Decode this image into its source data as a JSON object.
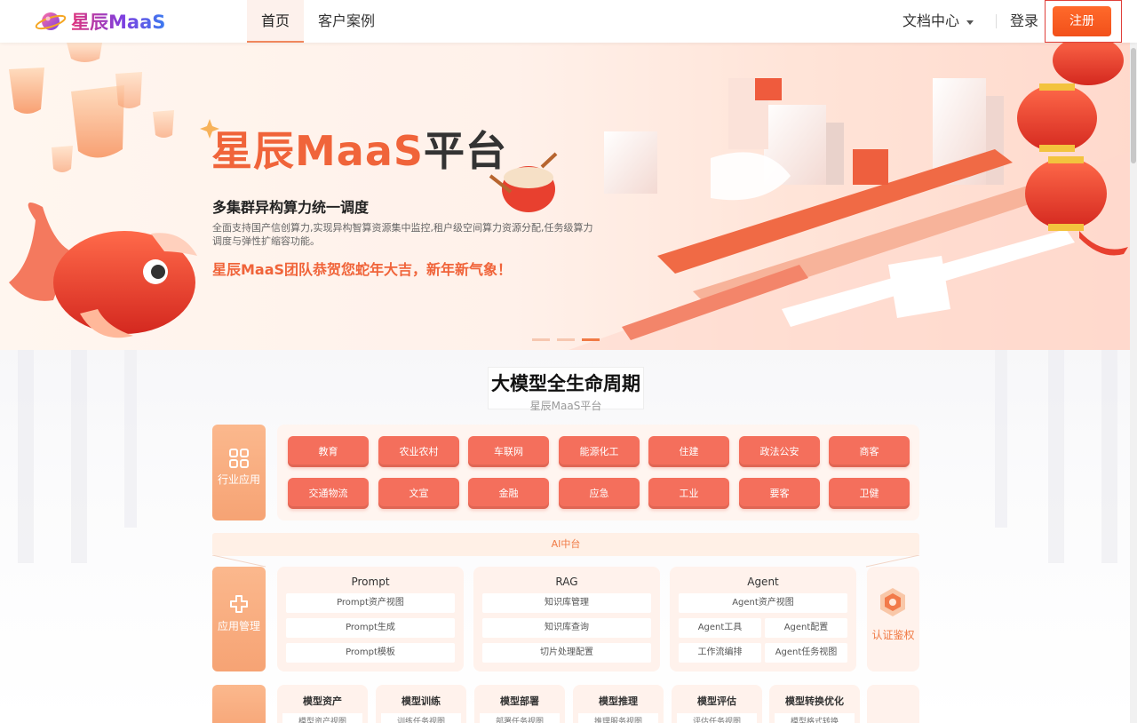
{
  "header": {
    "brand": "星辰MaaS",
    "nav": [
      {
        "label": "首页",
        "active": true
      },
      {
        "label": "客户案例",
        "active": false
      }
    ],
    "docs_label": "文档中心",
    "login_label": "登录",
    "register_label": "注册"
  },
  "banner": {
    "title_part1": "星辰MaaS",
    "title_part2": "平台",
    "subtitle": "多集群异构算力统一调度",
    "description": "全面支持国产信创算力,实现异构智算资源集中监控,租户级空间算力资源分配,任务级算力调度与弹性扩缩容功能。",
    "greeting": "星辰MaaS团队恭贺您蛇年大吉，新年新气象！",
    "slide_indicator": {
      "count": 3,
      "active": 3
    }
  },
  "lifecycle": {
    "title": "大模型全生命周期",
    "subtitle": "星辰MaaS平台",
    "industry_label": "行业应用",
    "industries": [
      "教育",
      "农业农村",
      "车联网",
      "能源化工",
      "住建",
      "政法公安",
      "商客",
      "交通物流",
      "文宣",
      "金融",
      "应急",
      "工业",
      "要客",
      "卫健"
    ],
    "ai_bar_label": "AI中台",
    "app_mgmt_label": "应用管理",
    "modules": [
      {
        "title": "Prompt",
        "items": [
          "Prompt资产视图",
          "Prompt生成",
          "Prompt模板"
        ]
      },
      {
        "title": "RAG",
        "items": [
          "知识库管理",
          "知识库查询",
          "切片处理配置"
        ]
      },
      {
        "title": "Agent",
        "items": [
          "Agent资产视图",
          "Agent工具",
          "Agent配置",
          "工作流编排",
          "Agent任务视图"
        ]
      }
    ],
    "auth_label": "认证鉴权",
    "model_stages": [
      {
        "title": "模型资产",
        "item": "模型资产视图"
      },
      {
        "title": "模型训练",
        "item": "训练任务视图"
      },
      {
        "title": "模型部署",
        "item": "部署任务视图"
      },
      {
        "title": "模型推理",
        "item": "推理服务视图"
      },
      {
        "title": "模型评估",
        "item": "评估任务视图"
      },
      {
        "title": "模型转换优化",
        "item": "模型格式转换"
      }
    ]
  },
  "colors": {
    "accent": "#f0643a",
    "industry_button": "#f46f5c",
    "tile": "#f6a374"
  }
}
